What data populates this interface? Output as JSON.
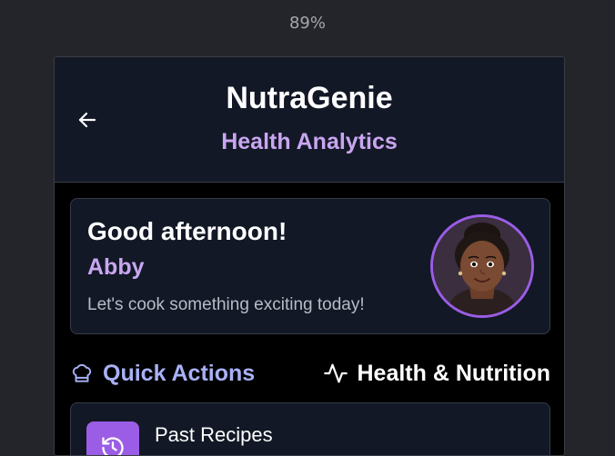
{
  "zoom": "89%",
  "header": {
    "title": "NutraGenie",
    "subtitle": "Health Analytics",
    "back_icon": "arrow-left-icon"
  },
  "greeting_card": {
    "greeting": "Good afternoon!",
    "name": "Abby",
    "tagline": "Let's cook something exciting today!",
    "avatar_icon": "user-avatar"
  },
  "sections": {
    "quick_actions": {
      "label": "Quick Actions",
      "icon": "chef-hat-icon"
    },
    "health_nutrition": {
      "label": "Health & Nutrition",
      "icon": "activity-icon"
    }
  },
  "actions": [
    {
      "label": "Past Recipes",
      "icon": "history-icon"
    }
  ],
  "colors": {
    "accent_purple": "#9b5de5",
    "subtitle_lavender": "#c9a6f0",
    "quick_actions_blue": "#a8b1f5",
    "card_bg": "#121826",
    "header_bg": "#131826"
  }
}
